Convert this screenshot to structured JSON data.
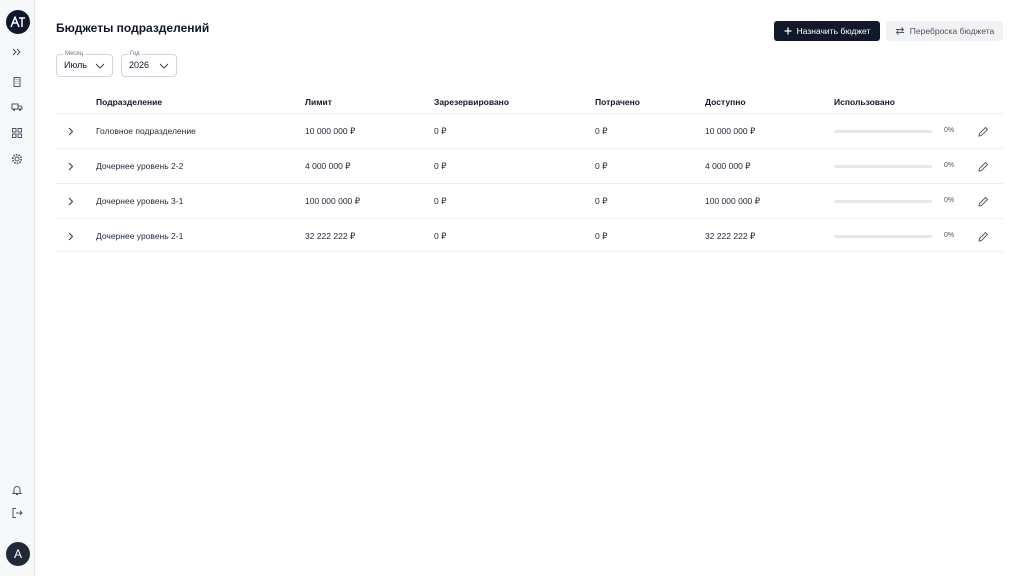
{
  "page": {
    "title": "Бюджеты подразделений",
    "assign_button": "Назначить бюджет",
    "transfer_button": "Переброска бюджета"
  },
  "filters": {
    "month": {
      "label": "Месяц",
      "value": "Июль"
    },
    "year": {
      "label": "Год",
      "value": "2026"
    }
  },
  "table": {
    "columns": [
      "Подразделение",
      "Лимит",
      "Зарезервировано",
      "Потрачено",
      "Доступно",
      "Использовано"
    ],
    "rows": [
      {
        "name": "Головное подразделение",
        "limit": "10 000 000 ₽",
        "reserved": "0 ₽",
        "spent": "0 ₽",
        "available": "10 000 000 ₽",
        "used": "0%",
        "used_fraction": 0
      },
      {
        "name": "Дочернее уровень 2-2",
        "limit": "4 000 000 ₽",
        "reserved": "0 ₽",
        "spent": "0 ₽",
        "available": "4 000 000 ₽",
        "used": "0%",
        "used_fraction": 0
      },
      {
        "name": "Дочернее уровень 3-1",
        "limit": "100 000 000 ₽",
        "reserved": "0 ₽",
        "spent": "0 ₽",
        "available": "100 000 000 ₽",
        "used": "0%",
        "used_fraction": 0
      },
      {
        "name": "Дочернее уровень 2-1",
        "limit": "32 222 222 ₽",
        "reserved": "0 ₽",
        "spent": "0 ₽",
        "available": "32 222 222 ₽",
        "used": "0%",
        "used_fraction": 0
      }
    ]
  },
  "sidebar": {
    "icons": [
      "expand-sidebar-icon",
      "building-icon",
      "truck-icon",
      "grid-icon",
      "gear-icon"
    ],
    "bottom_icons": [
      "bell-icon",
      "logout-icon"
    ],
    "avatar_initial": "A"
  },
  "colors": {
    "primary": "#111827",
    "secondary_bg": "#f1f2f4",
    "border": "#e5e7eb"
  }
}
